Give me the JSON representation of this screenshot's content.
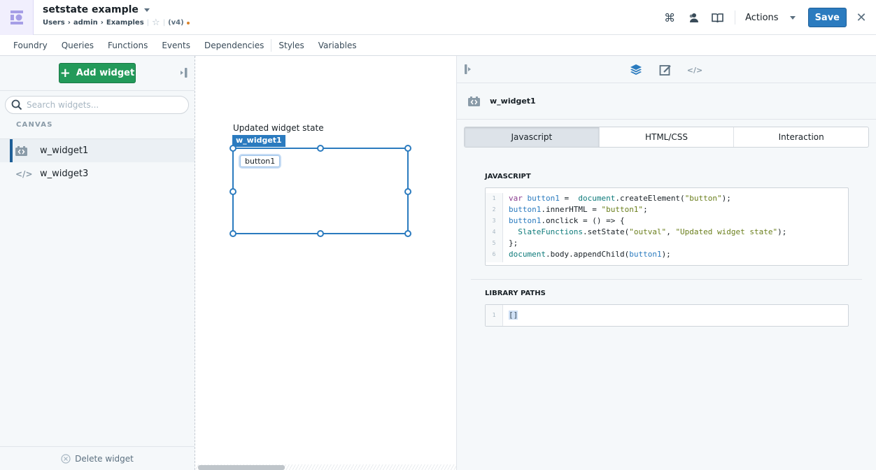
{
  "app": {
    "logo_icon": "slate-app-icon",
    "title": "setstate example",
    "breadcrumb": [
      "Users",
      "admin",
      "Examples"
    ],
    "version": "(v4)",
    "unsaved_indicator_color": "#d9822b"
  },
  "toolbar": {
    "icons": [
      "command-icon",
      "people-icon",
      "book-icon"
    ],
    "actions_label": "Actions",
    "save_label": "Save",
    "close_icon": "close-icon"
  },
  "menu": {
    "items": [
      "Foundry",
      "Queries",
      "Functions",
      "Events",
      "Dependencies",
      "Styles",
      "Variables"
    ]
  },
  "left_panel": {
    "add_widget_label": "Add widget",
    "search_placeholder": "Search widgets...",
    "section_label": "CANVAS",
    "widgets": [
      {
        "name": "w_widget1",
        "icon": "code-sandbox-icon",
        "selected": true
      },
      {
        "name": "w_widget3",
        "icon": "code-icon",
        "selected": false
      }
    ],
    "delete_label": "Delete widget"
  },
  "canvas": {
    "state_text": "Updated widget state",
    "selected_widget_tag": "w_widget1",
    "inner_button_label": "button1"
  },
  "right_panel": {
    "tabs": [
      "layers-icon",
      "edit-style-icon",
      "code-icon"
    ],
    "active_tab": "layers-icon",
    "widget_name": "w_widget1",
    "segments": [
      "Javascript",
      "HTML/CSS",
      "Interaction"
    ],
    "active_segment": "Javascript",
    "javascript_title": "JAVASCRIPT",
    "javascript_lines": [
      "var button1 =  document.createElement(\"button\");",
      "button1.innerHTML = \"button1\";",
      "button1.onclick = () => {",
      "  SlateFunctions.setState(\"outval\", \"Updated widget state\");",
      "};",
      "document.body.appendChild(button1);"
    ],
    "library_title": "LIBRARY PATHS",
    "library_lines": [
      "[]"
    ]
  },
  "colors": {
    "accent_blue": "#2b7bbf",
    "add_green": "#239a5a",
    "logo_purple": "#a69ee6"
  }
}
